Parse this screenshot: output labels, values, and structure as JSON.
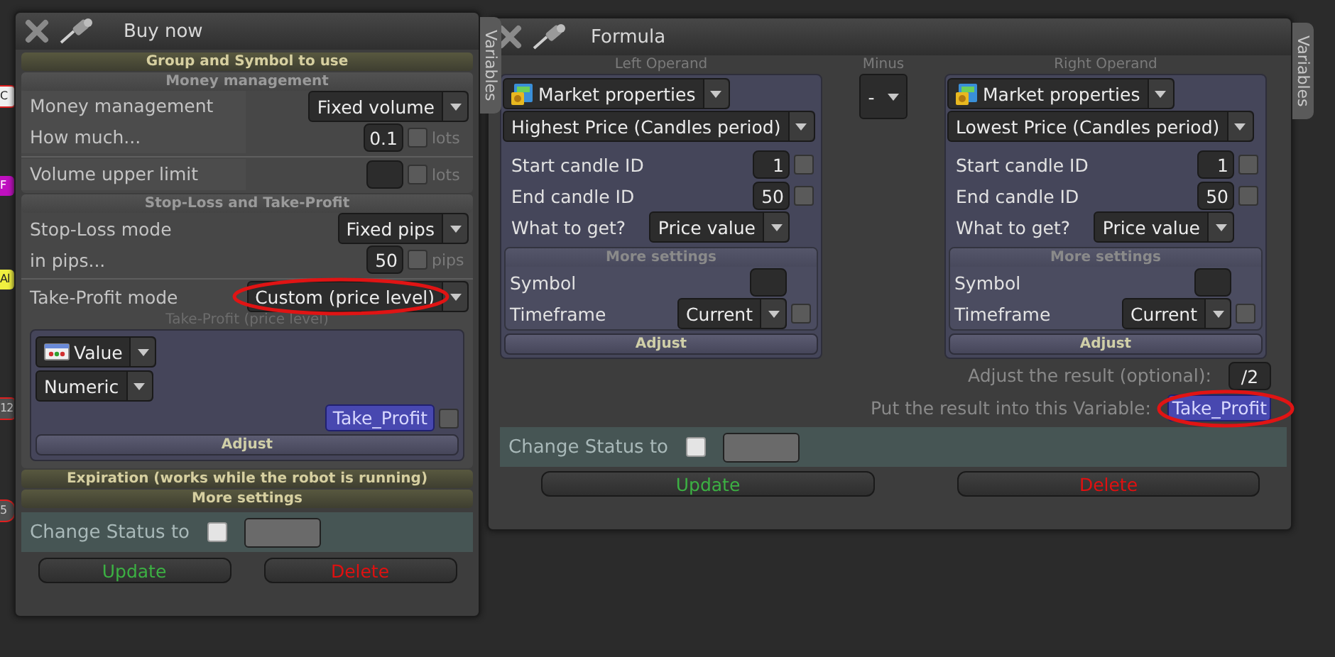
{
  "background_tags": [
    {
      "text": "C",
      "color": "#f0f0f0"
    },
    {
      "text": "F",
      "color": "#c010c0"
    },
    {
      "text": "Al",
      "color": "#f0f040"
    },
    {
      "text": "12",
      "color": "#505050"
    },
    {
      "text": "5",
      "color": "#505050"
    }
  ],
  "buy_window": {
    "title": "Buy now",
    "side_tab": "Variables",
    "group_bar": "Group and Symbol to use",
    "sections": [
      {
        "title": "Money management",
        "groups": [
          [
            {
              "kind": "dropdown",
              "label": "Money management",
              "value": "Fixed volume"
            },
            {
              "kind": "input",
              "label": "How much...",
              "value": "0.1",
              "checked": false,
              "unit": "lots"
            }
          ],
          [
            {
              "kind": "input",
              "label": "Volume upper limit",
              "checked": false,
              "unit": "lots"
            }
          ]
        ]
      },
      {
        "title": "Stop-Loss and Take-Profit",
        "groups": [
          [
            {
              "kind": "dropdown",
              "label": "Stop-Loss mode",
              "value": "Fixed pips"
            },
            {
              "kind": "input",
              "label": "in pips...",
              "value": "50",
              "checked": false,
              "unit": "pips"
            }
          ],
          [
            {
              "kind": "dropdown",
              "label": "Take-Profit mode",
              "value": "Custom (price level)"
            }
          ]
        ],
        "subpanel": {
          "title": "Take-Profit (price level)",
          "source": "Value",
          "type": "Numeric",
          "variable": {
            "value": "Take_Profit",
            "checked": false
          },
          "button": "Adjust"
        }
      }
    ],
    "bottom_bars": [
      "Expiration (works while the robot is running)",
      "More settings"
    ],
    "change_status": {
      "label": "Change Status to",
      "checked": false
    },
    "buttons": [
      {
        "label": "Update",
        "kind": "update"
      },
      {
        "label": "Delete",
        "kind": "delete"
      }
    ]
  },
  "formula_window": {
    "title": "Formula",
    "side_tab": "Variables",
    "operands": [
      {
        "caption": "Left Operand",
        "source": "Market properties",
        "property": "Highest Price (Candles period)",
        "fields": [
          {
            "label": "Start candle ID",
            "value": "1",
            "checked": false
          },
          {
            "label": "End candle ID",
            "value": "50",
            "checked": false
          }
        ],
        "what_to_get": {
          "label": "What to get?",
          "value": "Price value"
        },
        "more_settings": {
          "title": "More settings",
          "symbol": {
            "label": "Symbol"
          },
          "timeframe": {
            "label": "Timeframe",
            "value": "Current",
            "checked": false
          }
        },
        "button": "Adjust"
      },
      {
        "caption": "Right Operand",
        "source": "Market properties",
        "property": "Lowest Price (Candles period)",
        "fields": [
          {
            "label": "Start candle ID",
            "value": "1",
            "checked": false
          },
          {
            "label": "End candle ID",
            "value": "50",
            "checked": false
          }
        ],
        "what_to_get": {
          "label": "What to get?",
          "value": "Price value"
        },
        "more_settings": {
          "title": "More settings",
          "symbol": {
            "label": "Symbol"
          },
          "timeframe": {
            "label": "Timeframe",
            "value": "Current",
            "checked": false
          }
        },
        "button": "Adjust"
      }
    ],
    "operator": {
      "caption": "Minus",
      "value": "-"
    },
    "adjust_result": {
      "label": "Adjust the result (optional):",
      "value": "/2"
    },
    "result_variable": {
      "label": "Put the result into this Variable:",
      "value": "Take_Profit"
    },
    "change_status": {
      "label": "Change Status to",
      "checked": false
    },
    "buttons": [
      {
        "label": "Update",
        "kind": "update"
      },
      {
        "label": "Delete",
        "kind": "delete"
      }
    ]
  }
}
